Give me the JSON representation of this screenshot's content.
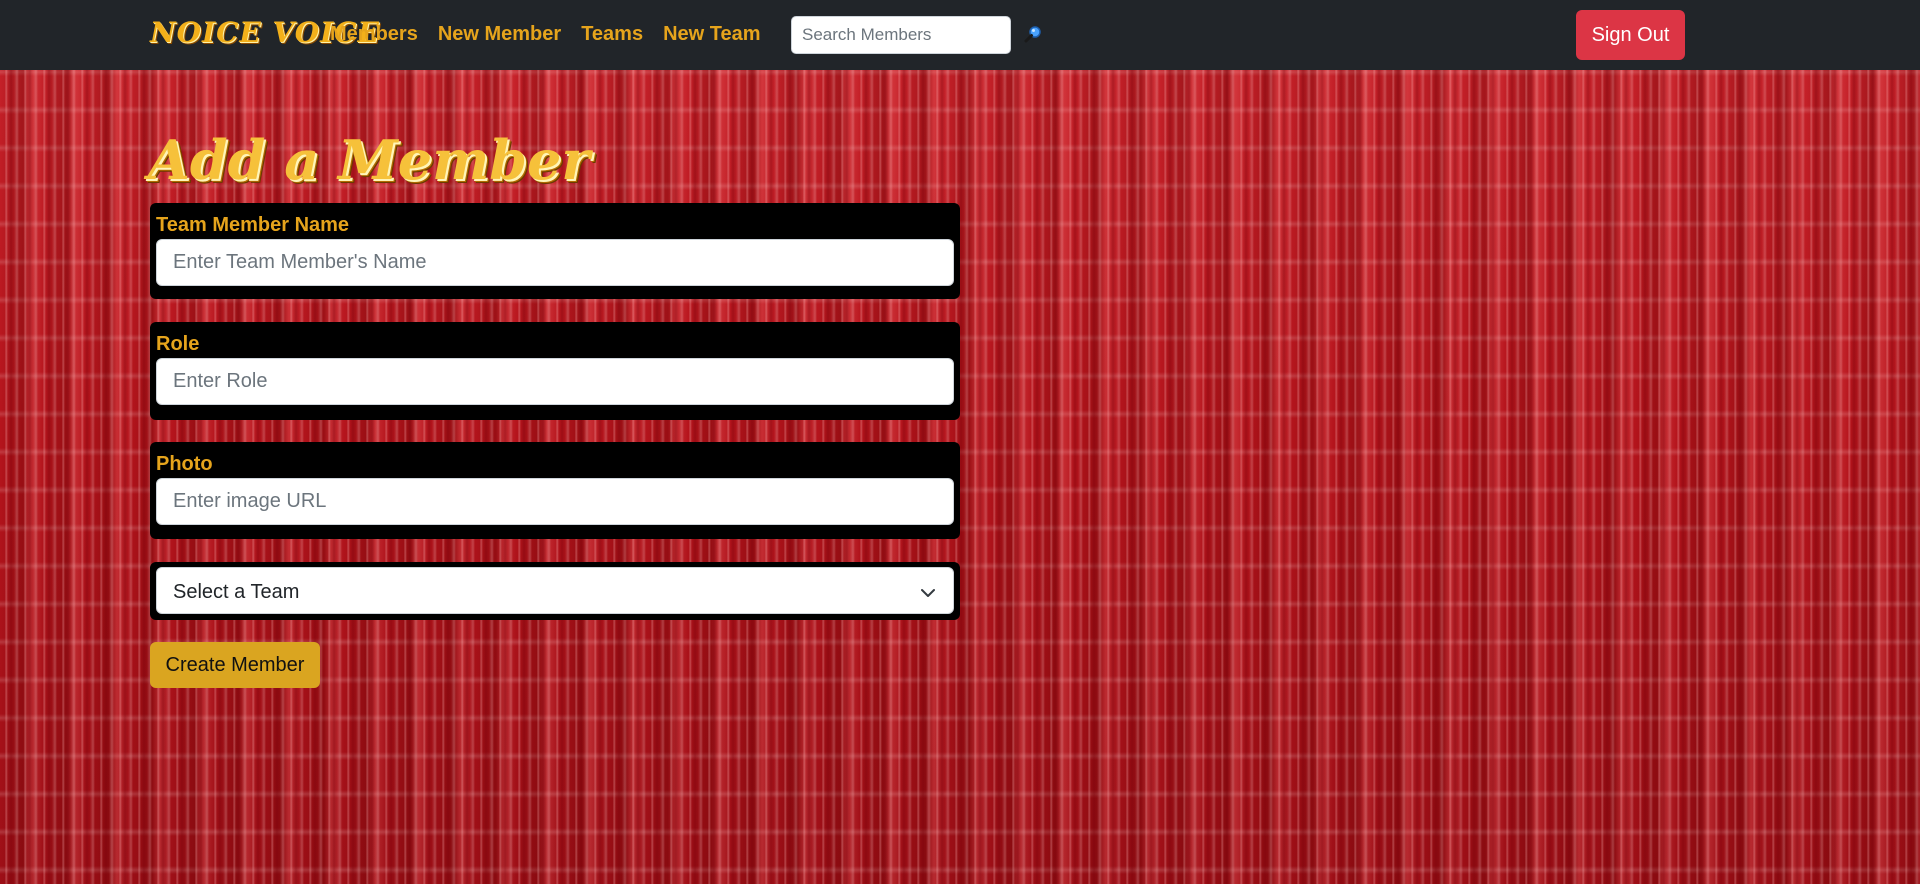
{
  "nav": {
    "brand": "NOICE VOICE",
    "links": [
      "Members",
      "New Member",
      "Teams",
      "New Team"
    ],
    "search_placeholder": "Search Members",
    "search_icon": "magnifying-glass-icon",
    "sign_out": "Sign Out"
  },
  "form": {
    "title": "Add a Member",
    "name_label": "Team Member Name",
    "name_placeholder": "Enter Team Member's Name",
    "role_label": "Role",
    "role_placeholder": "Enter Role",
    "photo_label": "Photo",
    "photo_placeholder": "Enter image URL",
    "team_select_value": "Select a Team",
    "submit": "Create Member"
  },
  "colors": {
    "navbar": "#212529",
    "accent_gold": "#e6a41c",
    "sign_out": "#dc3545",
    "submit": "#daa520"
  }
}
